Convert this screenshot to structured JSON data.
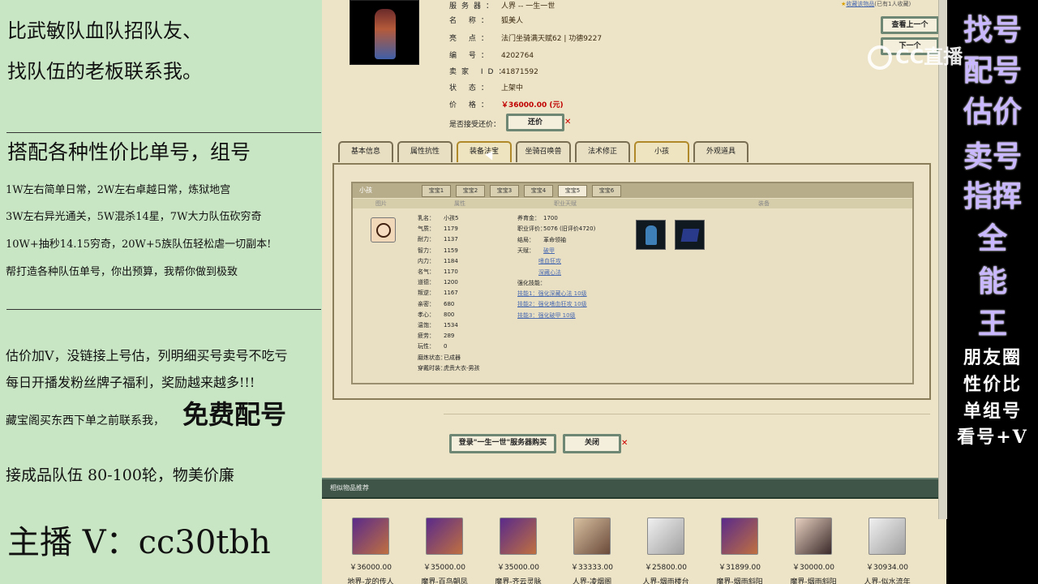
{
  "left": {
    "line1": "比武敏队血队招队友、",
    "line2": "找队伍的老板联系我。",
    "line3": "搭配各种性价比单号，组号",
    "line4": "1W左右简单日常，2W左右卓越日常，炼狱地宫",
    "line5": "3W左右异光通关，5W混杀14星，7W大力队伍砍穷奇",
    "line6": "10W+抽秒14.15穷奇，20W+5族队伍轻松虐一切副本!",
    "line7": "帮打造各种队伍单号，你出预算，我帮你做到极致",
    "line8": "估价加V，没链接上号估，列明细买号卖号不吃亏",
    "line9": "每日开播发粉丝牌子福利，奖励越来越多!!!",
    "line10a": "藏宝阁买东西下单之前联系我，",
    "line10b": "免费配号",
    "line11": "接成品队伍 80-100轮，物美价廉",
    "line12": "主播 V：cc30tbh"
  },
  "header": {
    "server_label": "服务器：",
    "server": "人界 -- 一生一世",
    "collect": "收藏该物品",
    "collect_count": "(已有1人收藏)",
    "fields": [
      {
        "k": "名 称：",
        "v": "狐美人"
      },
      {
        "k": "亮 点：",
        "v": "法门坐骑满天赋62 | 功德9227"
      },
      {
        "k": "编 号：",
        "v": "4202764"
      },
      {
        "k": "卖家 ID：",
        "v": "41871592"
      },
      {
        "k": "状 态：",
        "v": "上架中"
      }
    ],
    "price_label": "价 格：",
    "price": "￥36000.00 (元)",
    "bargain_label": "是否接受还价：",
    "bargain_btn": "还价",
    "prev_btn": "查看上一个",
    "next_btn": "下一个"
  },
  "tabs": [
    "基本信息",
    "属性抗性",
    "装备法宝",
    "坐骑召唤兽",
    "法术修正",
    "小孩",
    "外观道具"
  ],
  "child": {
    "title": "小孩",
    "subtabs": [
      "宝宝1",
      "宝宝2",
      "宝宝3",
      "宝宝4",
      "宝宝5",
      "宝宝6"
    ],
    "cols": [
      "图片",
      "属性",
      "职业天赋",
      "装备"
    ],
    "left": [
      {
        "k": "乳名：",
        "v": "小孩5"
      },
      {
        "k": "气质：",
        "v": "1179"
      },
      {
        "k": "耐力：",
        "v": "1137"
      },
      {
        "k": "智力：",
        "v": "1159"
      },
      {
        "k": "内力：",
        "v": "1184"
      },
      {
        "k": "名气：",
        "v": "1170"
      },
      {
        "k": "道德：",
        "v": "1200"
      },
      {
        "k": "叛逆：",
        "v": "1167"
      },
      {
        "k": "亲密：",
        "v": "680"
      },
      {
        "k": "孝心：",
        "v": "800"
      },
      {
        "k": "温饱：",
        "v": "1534"
      },
      {
        "k": "疲劳：",
        "v": "289"
      },
      {
        "k": "玩性：",
        "v": "0"
      },
      {
        "k": "磨炼状态：",
        "v": "已成器"
      },
      {
        "k": "穿戴时装：",
        "v": "虎贲大衣-男孩"
      }
    ],
    "mid": [
      {
        "k": "养育金：",
        "v": "1700"
      },
      {
        "k": "职业评价：",
        "v": "5076 (旧评价4720)"
      },
      {
        "k": "结局：",
        "v": "革命领袖"
      },
      {
        "k": "天赋：",
        "v": "破甲"
      }
    ],
    "talents": [
      "嗜血狂攻",
      "深藏心法"
    ],
    "skill_label": "强化技能：",
    "skills": [
      "技能1：强化深藏心法 10级",
      "技能2：强化嗜血狂攻 10级",
      "技能3：强化破甲 10级"
    ]
  },
  "actions": {
    "login": "登录\"一生一世\"服务器购买",
    "close": "关闭"
  },
  "similar": {
    "title": "相似物品推荐",
    "items": [
      {
        "price": "￥36000.00",
        "name": "地界-龙的传人"
      },
      {
        "price": "￥35000.00",
        "name": "魔界-百鸟朝凤"
      },
      {
        "price": "￥35000.00",
        "name": "魔界-齐云灵脉"
      },
      {
        "price": "￥33333.00",
        "name": "人界-凌烟阁"
      },
      {
        "price": "￥25800.00",
        "name": "人界-烟雨楼台"
      },
      {
        "price": "￥31899.00",
        "name": "魔界-烟雨斜阳"
      },
      {
        "price": "￥30000.00",
        "name": "魔界-烟雨斜阳"
      },
      {
        "price": "￥30934.00",
        "name": "人界-似水流年"
      }
    ]
  },
  "right": {
    "chars": [
      "找号",
      "配号",
      "估价",
      "卖号",
      "指挥",
      "全",
      "能",
      "王"
    ],
    "lines": [
      "朋友圈",
      "性价比",
      "单组号",
      "看号+V"
    ]
  },
  "watermark": "CC直播"
}
